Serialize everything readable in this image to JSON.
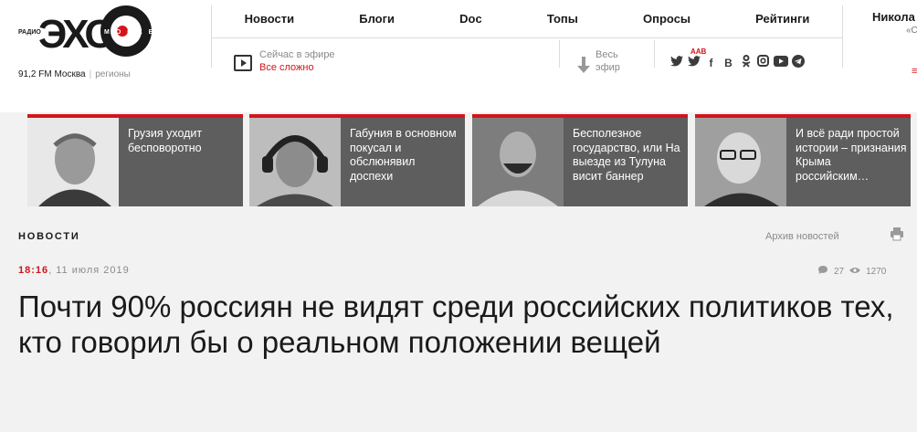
{
  "logo": {
    "radio": "РАДИО",
    "echo": "ЭХО",
    "moskvy": "МОСКВЫ",
    "frequency": "91,2 FM Москва",
    "regions": "регионы"
  },
  "nav": [
    "Новости",
    "Блоги",
    "Doc",
    "Топы",
    "Опросы",
    "Рейтинги"
  ],
  "user": {
    "name": "Никола",
    "extra": "«С"
  },
  "onair": {
    "label": "Сейчас в эфире",
    "show": "Все сложно"
  },
  "archive_air": {
    "line1": "Весь",
    "line2": "эфир"
  },
  "social": {
    "aab_label": "AAB",
    "icons": [
      "twitter-icon",
      "twitter-aab-icon",
      "facebook-icon",
      "vk-icon",
      "odnoklassniki-icon",
      "instagram-icon",
      "youtube-icon",
      "telegram-icon"
    ]
  },
  "cards": [
    {
      "text": "Грузия уходит бесповоротно"
    },
    {
      "text": "Габуния в основном покусал и обслюнявил доспехи"
    },
    {
      "text": "Бесполезное государство, или На выезде из Тулуна висит баннер"
    },
    {
      "text": "И всё ради простой истории – признания Крыма российским…"
    }
  ],
  "section": {
    "label": "НОВОСТИ",
    "archive": "Архив новостей"
  },
  "article": {
    "time": "18:16",
    "date": ", 11 июля 2019",
    "comments": "27",
    "views": "1270",
    "headline": "Почти 90% россиян не видят среди российских политиков тех, кто говорил бы о реальном положении вещей"
  },
  "colors": {
    "accent": "#d4141b",
    "card_bg": "#5e5e5e",
    "page_bg": "#f2f2f2"
  }
}
